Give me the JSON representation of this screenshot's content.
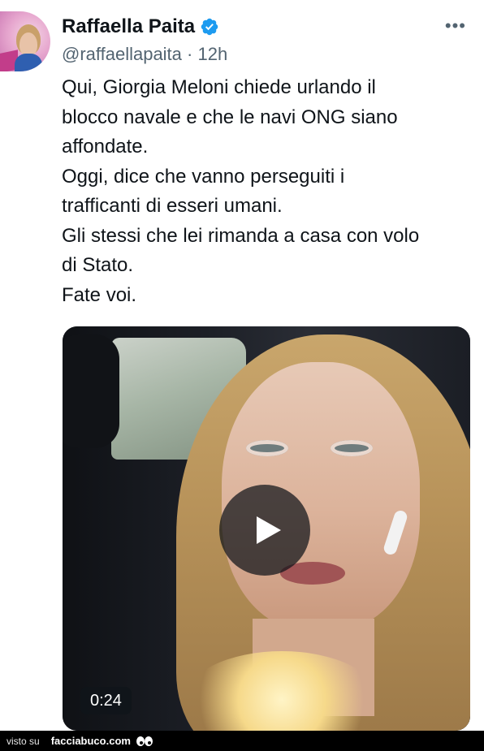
{
  "author": {
    "name": "Raffaella Paita",
    "handle": "@raffaellapaita",
    "separator": "·",
    "time": "12h",
    "verified_color": "#1d9bf0"
  },
  "more_label": "•••",
  "tweet_lines": [
    "Qui, Giorgia Meloni chiede urlando il",
    "blocco navale e che le navi ONG siano",
    "affondate.",
    "Oggi, dice che vanno perseguiti i",
    "trafficanti di esseri umani.",
    "Gli stessi che lei rimanda a casa con volo",
    "di Stato.",
    "Fate voi."
  ],
  "media": {
    "duration": "0:24",
    "play_icon": "play-icon"
  },
  "footer": {
    "visto_label": "visto su",
    "site_label": "facciabuco.com",
    "logo_icon": "eyes-icon"
  }
}
